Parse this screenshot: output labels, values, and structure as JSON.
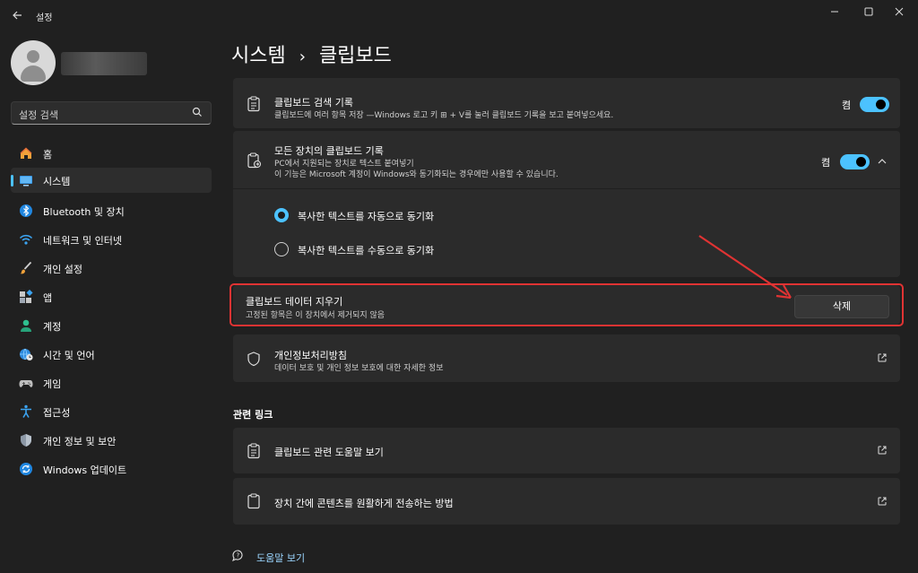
{
  "app": {
    "title": "설정"
  },
  "search": {
    "placeholder": "설정 검색"
  },
  "sidebar": {
    "items": [
      {
        "label": "홈",
        "icon": "home-icon"
      },
      {
        "label": "시스템",
        "icon": "system-icon",
        "active": true
      },
      {
        "label": "Bluetooth 및 장치",
        "icon": "bluetooth-icon"
      },
      {
        "label": "네트워크 및 인터넷",
        "icon": "wifi-icon"
      },
      {
        "label": "개인 설정",
        "icon": "brush-icon"
      },
      {
        "label": "앱",
        "icon": "apps-icon"
      },
      {
        "label": "계정",
        "icon": "account-icon"
      },
      {
        "label": "시간 및 언어",
        "icon": "globe-clock-icon"
      },
      {
        "label": "게임",
        "icon": "gamepad-icon"
      },
      {
        "label": "접근성",
        "icon": "accessibility-icon"
      },
      {
        "label": "개인 정보 및 보안",
        "icon": "shield-icon"
      },
      {
        "label": "Windows 업데이트",
        "icon": "update-icon"
      }
    ]
  },
  "header": {
    "breadcrumb_parent": "시스템",
    "separator": "›",
    "breadcrumb_current": "클립보드"
  },
  "history": {
    "title": "클립보드 검색 기록",
    "subtitle": "클립보드에 여러 항목 저장 —Windows 로고 키 ⊞ + V를 눌러 클립보드 기록을 보고 붙여넣으세요.",
    "toggle_label": "켬",
    "toggle_on": true
  },
  "sync": {
    "title": "모든 장치의 클립보드 기록",
    "subtitle1": "PC에서 지원되는 장치로 텍스트 붙여넣기",
    "subtitle2": "이 기능은 Microsoft 계정이 Windows와 동기화되는 경우에만 사용할 수 있습니다.",
    "toggle_label": "켬",
    "toggle_on": true,
    "options": [
      {
        "label": "복사한 텍스트를 자동으로 동기화",
        "selected": true
      },
      {
        "label": "복사한 텍스트를 수동으로 동기화",
        "selected": false
      }
    ]
  },
  "clear": {
    "title": "클립보드 데이터 지우기",
    "subtitle": "고정된 항목은 이 장치에서 제거되지 않음",
    "button": "삭제"
  },
  "privacy": {
    "title": "개인정보처리방침",
    "subtitle": "데이터 보호 및 개인 정보 보호에 대한 자세한 정보"
  },
  "related": {
    "heading": "관련 링크",
    "links": [
      {
        "label": "클립보드 관련 도움말 보기"
      },
      {
        "label": "장치 간에 콘텐츠를 원활하게 전송하는 방법"
      }
    ]
  },
  "footer": {
    "help": "도움말 보기"
  },
  "colors": {
    "accent": "#4cc2ff",
    "annotation": "#e03333",
    "background": "#202020",
    "card": "#2b2b2b"
  }
}
